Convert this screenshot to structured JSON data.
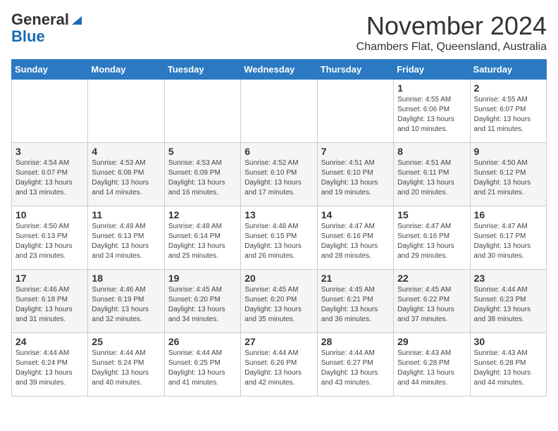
{
  "logo": {
    "general": "General",
    "blue": "Blue"
  },
  "title": "November 2024",
  "subtitle": "Chambers Flat, Queensland, Australia",
  "days_header": [
    "Sunday",
    "Monday",
    "Tuesday",
    "Wednesday",
    "Thursday",
    "Friday",
    "Saturday"
  ],
  "weeks": [
    [
      {
        "day": "",
        "info": ""
      },
      {
        "day": "",
        "info": ""
      },
      {
        "day": "",
        "info": ""
      },
      {
        "day": "",
        "info": ""
      },
      {
        "day": "",
        "info": ""
      },
      {
        "day": "1",
        "info": "Sunrise: 4:55 AM\nSunset: 6:06 PM\nDaylight: 13 hours\nand 10 minutes."
      },
      {
        "day": "2",
        "info": "Sunrise: 4:55 AM\nSunset: 6:07 PM\nDaylight: 13 hours\nand 11 minutes."
      }
    ],
    [
      {
        "day": "3",
        "info": "Sunrise: 4:54 AM\nSunset: 6:07 PM\nDaylight: 13 hours\nand 13 minutes."
      },
      {
        "day": "4",
        "info": "Sunrise: 4:53 AM\nSunset: 6:08 PM\nDaylight: 13 hours\nand 14 minutes."
      },
      {
        "day": "5",
        "info": "Sunrise: 4:53 AM\nSunset: 6:09 PM\nDaylight: 13 hours\nand 16 minutes."
      },
      {
        "day": "6",
        "info": "Sunrise: 4:52 AM\nSunset: 6:10 PM\nDaylight: 13 hours\nand 17 minutes."
      },
      {
        "day": "7",
        "info": "Sunrise: 4:51 AM\nSunset: 6:10 PM\nDaylight: 13 hours\nand 19 minutes."
      },
      {
        "day": "8",
        "info": "Sunrise: 4:51 AM\nSunset: 6:11 PM\nDaylight: 13 hours\nand 20 minutes."
      },
      {
        "day": "9",
        "info": "Sunrise: 4:50 AM\nSunset: 6:12 PM\nDaylight: 13 hours\nand 21 minutes."
      }
    ],
    [
      {
        "day": "10",
        "info": "Sunrise: 4:50 AM\nSunset: 6:13 PM\nDaylight: 13 hours\nand 23 minutes."
      },
      {
        "day": "11",
        "info": "Sunrise: 4:49 AM\nSunset: 6:13 PM\nDaylight: 13 hours\nand 24 minutes."
      },
      {
        "day": "12",
        "info": "Sunrise: 4:48 AM\nSunset: 6:14 PM\nDaylight: 13 hours\nand 25 minutes."
      },
      {
        "day": "13",
        "info": "Sunrise: 4:48 AM\nSunset: 6:15 PM\nDaylight: 13 hours\nand 26 minutes."
      },
      {
        "day": "14",
        "info": "Sunrise: 4:47 AM\nSunset: 6:16 PM\nDaylight: 13 hours\nand 28 minutes."
      },
      {
        "day": "15",
        "info": "Sunrise: 4:47 AM\nSunset: 6:16 PM\nDaylight: 13 hours\nand 29 minutes."
      },
      {
        "day": "16",
        "info": "Sunrise: 4:47 AM\nSunset: 6:17 PM\nDaylight: 13 hours\nand 30 minutes."
      }
    ],
    [
      {
        "day": "17",
        "info": "Sunrise: 4:46 AM\nSunset: 6:18 PM\nDaylight: 13 hours\nand 31 minutes."
      },
      {
        "day": "18",
        "info": "Sunrise: 4:46 AM\nSunset: 6:19 PM\nDaylight: 13 hours\nand 32 minutes."
      },
      {
        "day": "19",
        "info": "Sunrise: 4:45 AM\nSunset: 6:20 PM\nDaylight: 13 hours\nand 34 minutes."
      },
      {
        "day": "20",
        "info": "Sunrise: 4:45 AM\nSunset: 6:20 PM\nDaylight: 13 hours\nand 35 minutes."
      },
      {
        "day": "21",
        "info": "Sunrise: 4:45 AM\nSunset: 6:21 PM\nDaylight: 13 hours\nand 36 minutes."
      },
      {
        "day": "22",
        "info": "Sunrise: 4:45 AM\nSunset: 6:22 PM\nDaylight: 13 hours\nand 37 minutes."
      },
      {
        "day": "23",
        "info": "Sunrise: 4:44 AM\nSunset: 6:23 PM\nDaylight: 13 hours\nand 38 minutes."
      }
    ],
    [
      {
        "day": "24",
        "info": "Sunrise: 4:44 AM\nSunset: 6:24 PM\nDaylight: 13 hours\nand 39 minutes."
      },
      {
        "day": "25",
        "info": "Sunrise: 4:44 AM\nSunset: 6:24 PM\nDaylight: 13 hours\nand 40 minutes."
      },
      {
        "day": "26",
        "info": "Sunrise: 4:44 AM\nSunset: 6:25 PM\nDaylight: 13 hours\nand 41 minutes."
      },
      {
        "day": "27",
        "info": "Sunrise: 4:44 AM\nSunset: 6:26 PM\nDaylight: 13 hours\nand 42 minutes."
      },
      {
        "day": "28",
        "info": "Sunrise: 4:44 AM\nSunset: 6:27 PM\nDaylight: 13 hours\nand 43 minutes."
      },
      {
        "day": "29",
        "info": "Sunrise: 4:43 AM\nSunset: 6:28 PM\nDaylight: 13 hours\nand 44 minutes."
      },
      {
        "day": "30",
        "info": "Sunrise: 4:43 AM\nSunset: 6:28 PM\nDaylight: 13 hours\nand 44 minutes."
      }
    ]
  ]
}
